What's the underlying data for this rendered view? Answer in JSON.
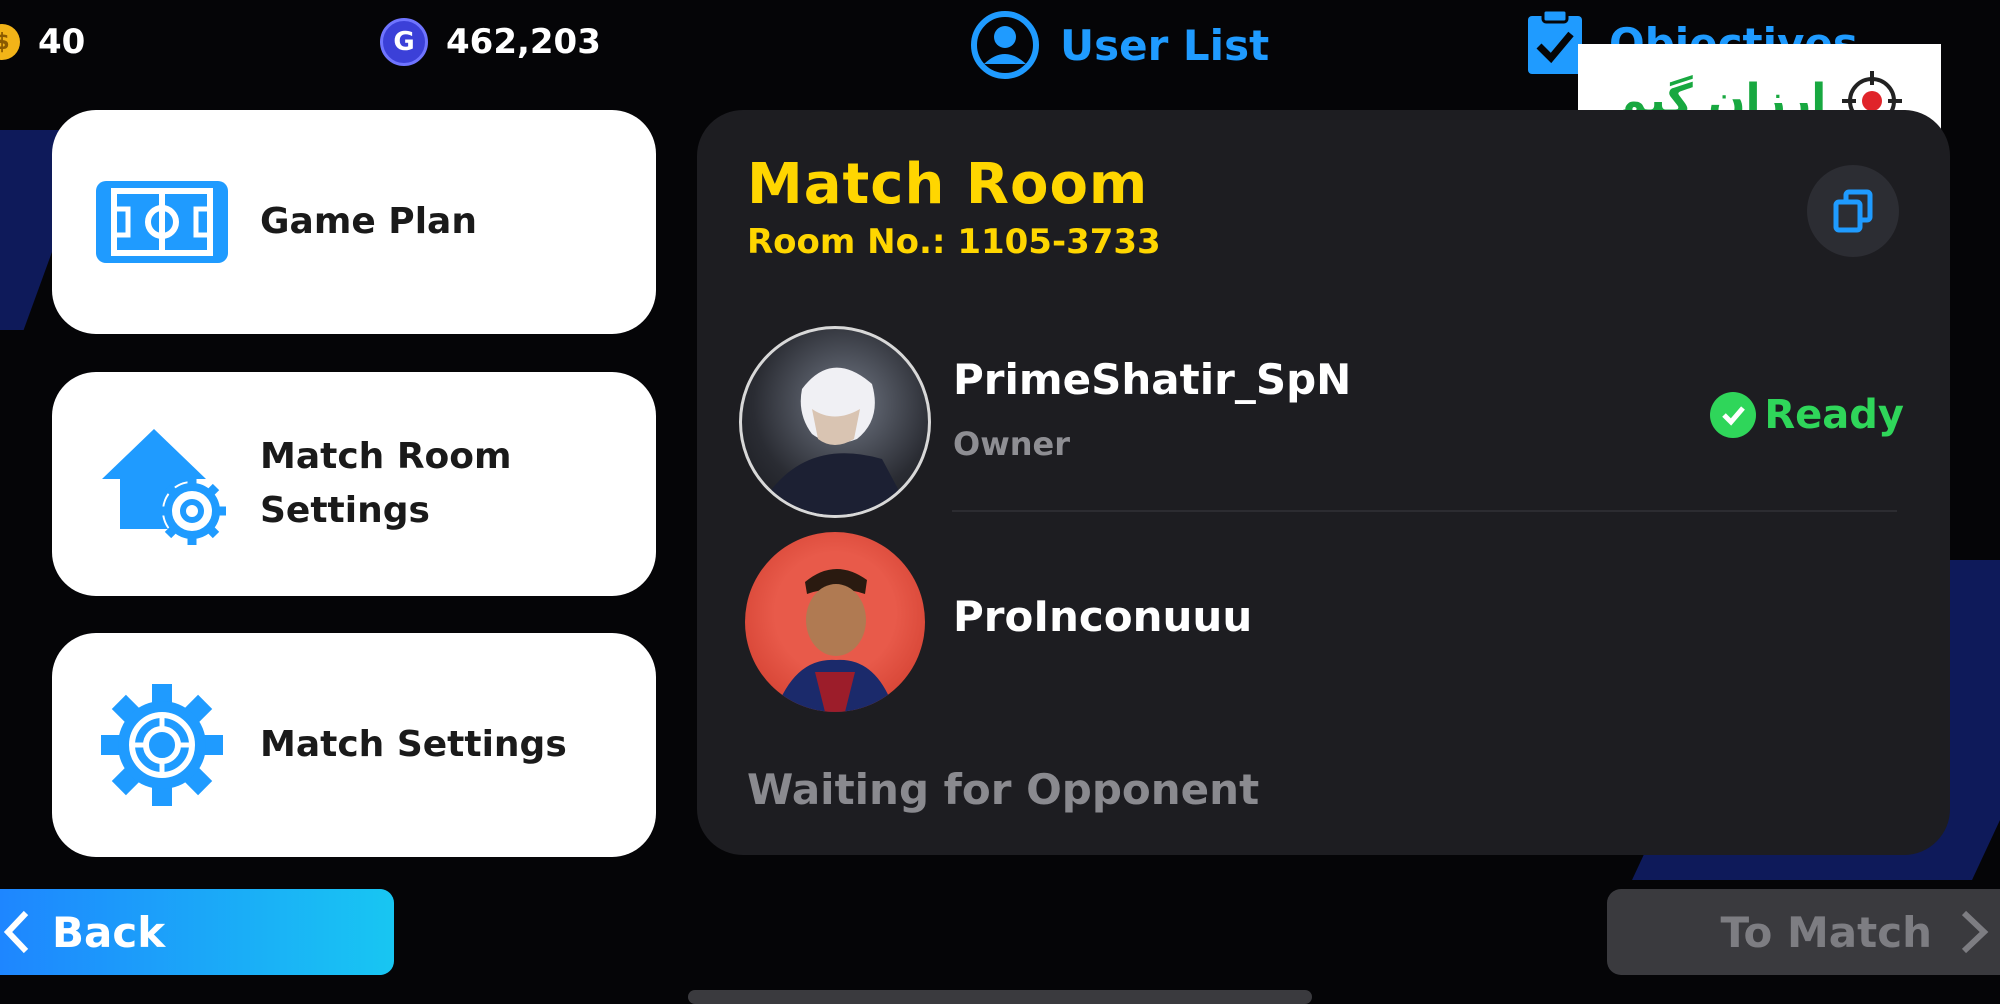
{
  "topbar": {
    "coins": "40",
    "gp": "462,203",
    "gp_icon_glyph": "G",
    "user_list_label": "User List",
    "objectives_label": "Objectives"
  },
  "menu": {
    "items": [
      {
        "label": "Game Plan",
        "icon": "game-plan-icon"
      },
      {
        "label": "Match Room\nSettings",
        "icon": "room-settings-icon"
      },
      {
        "label": "Match Settings",
        "icon": "gear-icon"
      }
    ]
  },
  "room": {
    "title": "Match Room",
    "room_no": "Room No.: 1105-3733",
    "players": [
      {
        "name": "PrimeShatir_SpN",
        "role": "Owner",
        "status": "Ready"
      },
      {
        "name": "ProInconuuu"
      }
    ],
    "waiting_text": "Waiting for Opponent"
  },
  "footer": {
    "back_label": "Back",
    "to_match_label": "To Match"
  },
  "watermark": {
    "text": "ارزان گیم"
  },
  "colors": {
    "accent_blue": "#1f9bff",
    "title_yellow": "#ffd600",
    "ready_green": "#2fd65a",
    "panel_bg": "#1d1d21"
  }
}
